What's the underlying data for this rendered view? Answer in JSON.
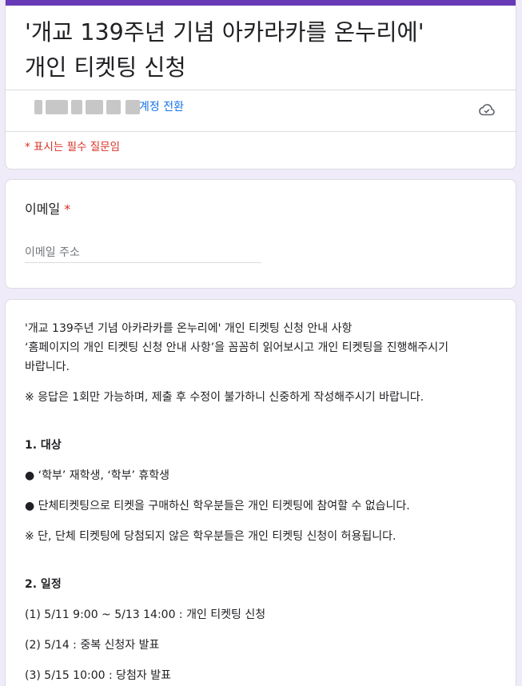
{
  "form": {
    "title_line1": "'개교 139주년 기념 아카라카를 온누리에'",
    "title_line2": "개인 티켓팅 신청",
    "switch_account": "계정 전환",
    "required_note": "* 표시는 필수 질문임",
    "accent_color": "#673ab7"
  },
  "email": {
    "label": "이메일",
    "required_mark": "*",
    "placeholder": "이메일 주소"
  },
  "info": {
    "intro_line1": "'개교 139주년 기념 아카라카를 온누리에' 개인 티켓팅 신청 안내 사항",
    "intro_line2": "‘홈페이지의 개인 티켓팅 신청 안내 사항’을 꼼꼼히 읽어보시고 개인 티켓팅을 진행해주시기",
    "intro_line3": "바랍니다.",
    "notice": "※ 응답은 1회만 가능하며, 제출 후 수정이 불가하니 신중하게 작성해주시기 바랍니다.",
    "target_heading": "1. 대상",
    "target_items": [
      "● ‘학부’ 재학생, ‘학부’ 휴학생",
      "● 단체티켓팅으로 티켓을 구매하신 학우분들은 개인 티켓팅에 참여할 수 없습니다.",
      "※  단, 단체 티켓팅에 당첨되지 않은 학우분들은 개인 티켓팅 신청이 허용됩니다."
    ],
    "schedule_heading": "2. 일정",
    "schedule_items": [
      "(1) 5/11 9:00 ~ 5/13 14:00 : 개인 티켓팅 신청",
      "(2) 5/14 : 중복 신청자 발표",
      "(3) 5/15 10:00 : 당첨자 발표"
    ]
  },
  "icons": {
    "cloud": "cloud-done-icon"
  }
}
